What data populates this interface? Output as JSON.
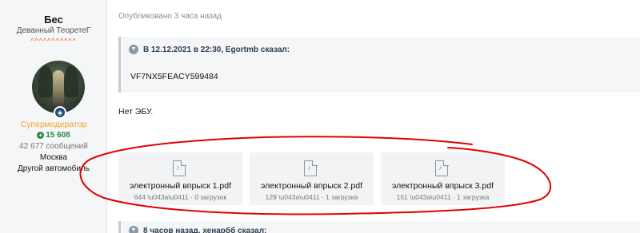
{
  "author": {
    "username": "Бес",
    "title": "Деванный ТеоретеГ",
    "banner": "^^^^^^^^^^^",
    "role": "Супермодератор",
    "reaction_score": "15 608",
    "messages": "42 677 сообщений",
    "location": "Москва",
    "car": "Другой автомобиль",
    "badge_icon": "shield-icon"
  },
  "post": {
    "published": "Опубликовано 3 часа назад",
    "quote": {
      "header": "В 12.12.2021 в 22:30, Egortmb сказал:",
      "text": "VF7NX5FEACY599484"
    },
    "reply": "Нет ЭБУ.",
    "attachments": [
      {
        "name": "электронный впрыск 1.pdf",
        "meta": "644 \\u043a\\u0411 · 0 загрузок",
        "icon": "pdf-icon"
      },
      {
        "name": "электронный впрыск 2.pdf",
        "meta": "129 \\u043a\\u0411 · 1 загрузка",
        "icon": "pdf-icon"
      },
      {
        "name": "электронный впрыск 3.pdf",
        "meta": "151 \\u043a\\u0411 · 1 загрузка",
        "icon": "pdf-icon"
      }
    ],
    "next_quote_header": "8 часов назад, хенарбб сказал:"
  },
  "colors": {
    "role": "#f9a01b",
    "reaction": "#2b8a3e",
    "annotation": "#e00000",
    "quote_border": "#c6ccd4"
  }
}
